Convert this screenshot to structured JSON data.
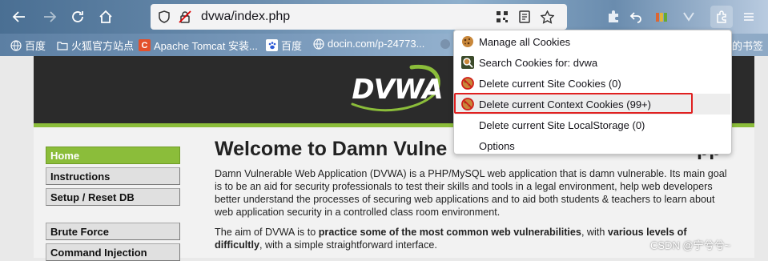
{
  "browser": {
    "url": "dvwa/index.php",
    "bookmarks": [
      {
        "label": "百度",
        "icon": "globe-icon"
      },
      {
        "label": "火狐官方站点",
        "icon": "folder-icon"
      },
      {
        "label": "Apache Tomcat 安装...",
        "icon": "c-logo-icon"
      },
      {
        "label": "百度",
        "icon": "paw-icon"
      },
      {
        "label": "docin.com/p-24773...",
        "icon": "globe-icon"
      },
      {
        "label": "的书签",
        "icon": "folder-icon"
      }
    ]
  },
  "page": {
    "logo": "DVWA",
    "menu": [
      {
        "label": "Home",
        "active": true
      },
      {
        "label": "Instructions",
        "active": false
      },
      {
        "label": "Setup / Reset DB",
        "active": false
      },
      {
        "label": "Brute Force",
        "active": false
      },
      {
        "label": "Command Injection",
        "active": false
      }
    ],
    "title": "Welcome to Damn Vulne",
    "title_tail": "pp",
    "para1": "Damn Vulnerable Web Application (DVWA) is a PHP/MySQL web application that is damn vulnerable. Its main goal is to be an aid for security professionals to test their skills and tools in a legal environment, help web developers better understand the processes of securing web applications and to aid both students & teachers to learn about web application security in a controlled class room environment.",
    "para2_a": "The aim of DVWA is to ",
    "para2_b": "practice some of the most common web vulnerabilities",
    "para2_c": ", with ",
    "para2_d": "various levels of difficultly",
    "para2_e": ", with a simple straightforward interface."
  },
  "popup": {
    "items": [
      {
        "label": "Manage all Cookies",
        "icon": "cookie-icon"
      },
      {
        "label": "Search Cookies for: dvwa",
        "icon": "search-cookie-icon"
      },
      {
        "label": "Delete current Site Cookies (0)",
        "icon": "delete-cookie-icon"
      },
      {
        "label": "Delete current Context Cookies (99+)",
        "icon": "delete-cookie-icon"
      },
      {
        "label": "Delete current Site LocalStorage (0)",
        "icon": ""
      },
      {
        "label": "Options",
        "icon": ""
      }
    ]
  },
  "watermark": "CSDN @宁兮兮~",
  "colors": {
    "accent_green": "#8bbd3a",
    "header_dark": "#2b2b2b",
    "highlight_red": "#e02020"
  }
}
